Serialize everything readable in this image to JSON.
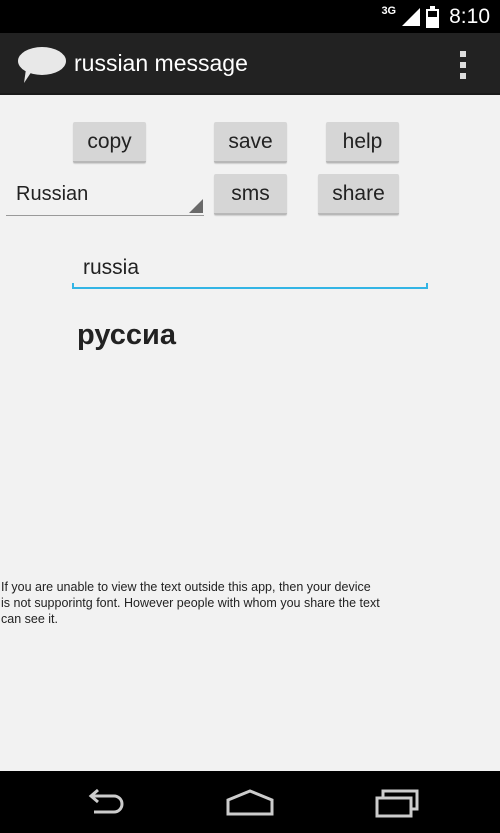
{
  "status_bar": {
    "network": "3G",
    "time": "8:10",
    "icons": [
      "signal-icon",
      "battery-icon"
    ]
  },
  "action_bar": {
    "app_icon": "speech-bubble-icon",
    "title": "russian message",
    "overflow_icon": "overflow-menu-icon"
  },
  "buttons": {
    "copy": "copy",
    "save": "save",
    "help": "help",
    "sms": "sms",
    "share": "share"
  },
  "language_spinner": {
    "selected": "Russian"
  },
  "input": {
    "value": "russia"
  },
  "output": {
    "converted_text": "руссиа"
  },
  "note": {
    "text": "If you are unable to view the text outside this app, then your device is not supporintg font. However people with whom you share the text can see it."
  },
  "nav_bar": {
    "icons": [
      "back-icon",
      "home-icon",
      "recents-icon"
    ]
  },
  "colors": {
    "status_bar": "#000000",
    "action_bar": "#222222",
    "background": "#f2f2f2",
    "button": "#d6d6d6",
    "input_accent": "#33b5e5"
  }
}
